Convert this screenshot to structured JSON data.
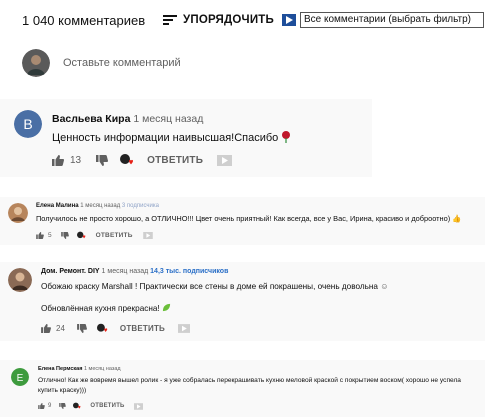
{
  "header": {
    "count": "1 040 комментариев",
    "sort_label": "УПОРЯДОЧИТЬ",
    "filter_value": "Все комментарии (выбрать фильтр)"
  },
  "add_comment": {
    "placeholder": "Оставьте комментарий"
  },
  "comments": [
    {
      "author": "Васльева Кира",
      "time": "1 месяц назад",
      "avatar_letter": "В",
      "avatar_color": "#4a6fa5",
      "text": "Ценность информации наивысшая!Спасибо",
      "likes": "13",
      "reply": "ОТВЕТИТЬ"
    },
    {
      "author": "Елена Малина",
      "time": "1 месяц назад",
      "subs": "3 подписчика",
      "text": "Получилось не просто хорошо, а ОТЛИЧНО!!! Цвет очень приятный! Как всегда, все у Вас, Ирина, красиво и доброотно)",
      "likes": "5",
      "reply": "ОТВЕТИТЬ"
    },
    {
      "author": "Дом. Ремонт. DIY",
      "time": "1 месяц назад",
      "subs": "14,3 тыс. подписчиков",
      "text_1": "Обожаю краску Marshall ! Практически все стены в доме ей покрашены, очень довольна",
      "text_2": "Обновлённая кухня прекрасна!",
      "likes": "24",
      "reply": "ОТВЕТИТЬ"
    },
    {
      "author": "Елена Пермская",
      "time": "1 месяц назад",
      "avatar_letter": "Е",
      "avatar_color": "#3e9b3e",
      "text_1": "Отлично! Как же вовремя вышел ролик - я уже собралась перекрашивать кухню меловой краской с покрытием воском( хорошо не успела",
      "text_2": "купить краску)))",
      "likes": "9",
      "reply": "ОТВЕТИТЬ"
    }
  ]
}
